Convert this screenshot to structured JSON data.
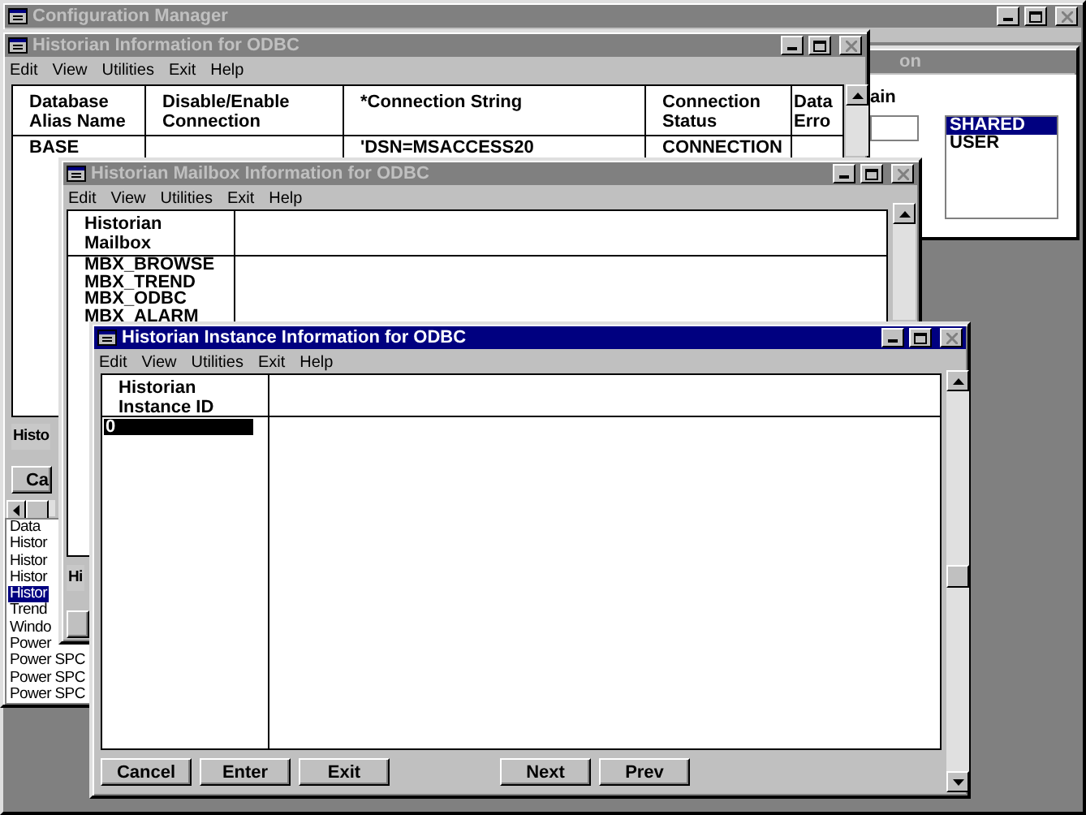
{
  "main_window": {
    "title": "Configuration Manager",
    "active": false
  },
  "domain_window": {
    "title": "on",
    "active": false,
    "field_label": "ain",
    "options": [
      {
        "label": "SHARED",
        "selected": true
      },
      {
        "label": "USER",
        "selected": false
      }
    ]
  },
  "odbc_window": {
    "title": "Historian Information for ODBC",
    "active": false,
    "menu": [
      "Edit",
      "View",
      "Utilities",
      "Exit",
      "Help"
    ],
    "table": {
      "columns": [
        "Database\nAlias Name",
        "Disable/Enable\nConnection",
        "*Connection String",
        "Connection\nStatus",
        "Data\nErro"
      ],
      "rows": [
        {
          "cells": [
            "BASE",
            null,
            "'DSN=MSACCESS20",
            "CONNECTION",
            null
          ]
        }
      ]
    },
    "label": "Histo",
    "button": "Ca",
    "list": [
      {
        "label": "Data",
        "selected": false
      },
      {
        "label": "Histor",
        "selected": false
      },
      {
        "label": "Histor",
        "selected": false
      },
      {
        "label": "Histor",
        "selected": false
      },
      {
        "label": "Histor",
        "selected": true
      },
      {
        "label": "Trend",
        "selected": false
      },
      {
        "label": "Windo",
        "selected": false
      },
      {
        "label": "Power",
        "selected": false
      },
      {
        "label": "Power SPC",
        "selected": false
      },
      {
        "label": "Power SPC",
        "selected": false
      },
      {
        "label": "Power SPC",
        "selected": false
      }
    ]
  },
  "mailbox_window": {
    "title": "Historian Mailbox Information for ODBC",
    "active": false,
    "menu": [
      "Edit",
      "View",
      "Utilities",
      "Exit",
      "Help"
    ],
    "table": {
      "columns": [
        "Historian\nMailbox"
      ],
      "rows": [
        {
          "cells": [
            "MBX_BROWSE"
          ]
        },
        {
          "cells": [
            "MBX_TREND"
          ]
        },
        {
          "cells": [
            "MBX_ODBC"
          ]
        },
        {
          "cells": [
            "MBX_ALARM"
          ]
        }
      ]
    },
    "label": "Hi"
  },
  "instance_window": {
    "title": "Historian Instance Information for ODBC",
    "active": true,
    "menu": [
      "Edit",
      "View",
      "Utilities",
      "Exit",
      "Help"
    ],
    "table": {
      "columns": [
        "Historian\nInstance ID"
      ],
      "rows": [
        {
          "cells": [
            "0"
          ],
          "selected": true
        }
      ]
    },
    "left_buttons": [
      "Cancel",
      "Enter",
      "Exit"
    ],
    "right_buttons": [
      "Next",
      "Prev"
    ]
  }
}
